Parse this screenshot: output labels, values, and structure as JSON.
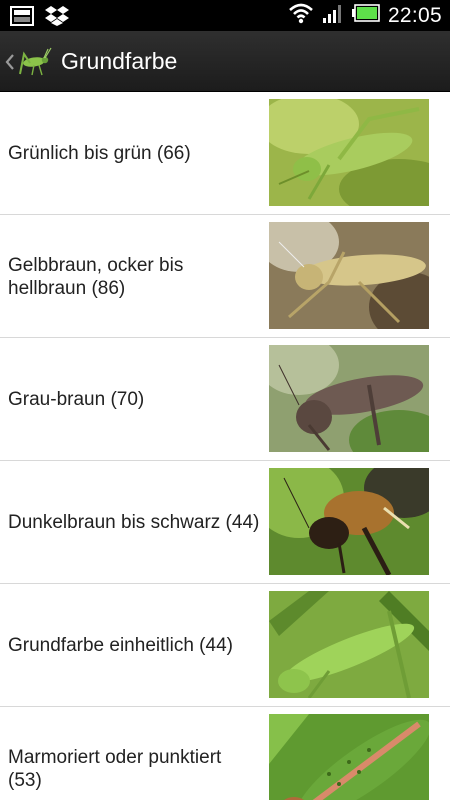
{
  "status_bar": {
    "time": "22:05",
    "icons": [
      "screenshot-icon",
      "dropbox-icon",
      "wifi-icon",
      "signal-icon",
      "battery-icon"
    ],
    "battery_color": "#5ee04a"
  },
  "action_bar": {
    "title": "Grundfarbe",
    "back_icon": "chevron-left-icon",
    "logo_icon": "grasshopper-icon"
  },
  "list": {
    "items": [
      {
        "label": "Grünlich bis grün (66)",
        "thumb": "green-grasshopper-photo"
      },
      {
        "label": "Gelbbraun, ocker bis hellbraun (86)",
        "thumb": "yellow-brown-grasshopper-photo"
      },
      {
        "label": "Grau-braun (70)",
        "thumb": "grey-brown-grasshopper-photo"
      },
      {
        "label": "Dunkelbraun bis schwarz (44)",
        "thumb": "dark-brown-cricket-photo"
      },
      {
        "label": "Grundfarbe einheitlich (44)",
        "thumb": "uniform-green-grasshopper-photo"
      },
      {
        "label": "Marmoriert oder punktiert (53)",
        "thumb": "speckled-grasshopper-photo"
      }
    ]
  }
}
